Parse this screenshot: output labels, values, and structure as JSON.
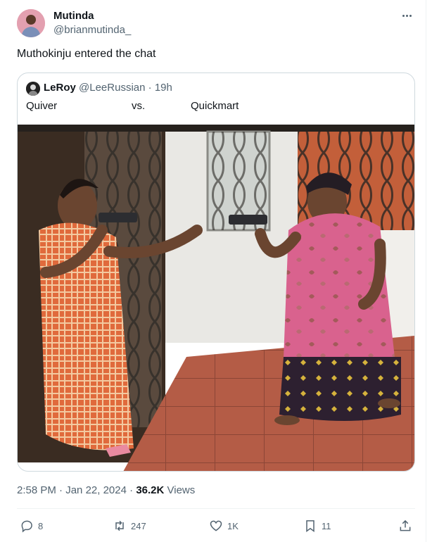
{
  "tweet": {
    "author_name": "Mutinda",
    "author_handle": "@brianmutinda_",
    "text": "Muthokinju entered the chat"
  },
  "quoted": {
    "author_name": "LeRoy",
    "author_handle": "@LeeRussian",
    "time_separator": " · ",
    "time": "19h",
    "text_parts": [
      "Quiver",
      "vs.",
      "Quickmart"
    ],
    "image_alt": "Two women in a doorway pointing handguns at each other"
  },
  "meta": {
    "time": "2:58 PM",
    "separator": " · ",
    "date": "Jan 22, 2024",
    "separator2": " · ",
    "views_count": "36.2K",
    "views_label": " Views"
  },
  "actions": {
    "replies": "8",
    "reposts": "247",
    "likes": "1K",
    "bookmarks": "11"
  },
  "icons": [
    "more-icon",
    "reply-icon",
    "repost-icon",
    "like-icon",
    "bookmark-icon",
    "share-icon"
  ]
}
